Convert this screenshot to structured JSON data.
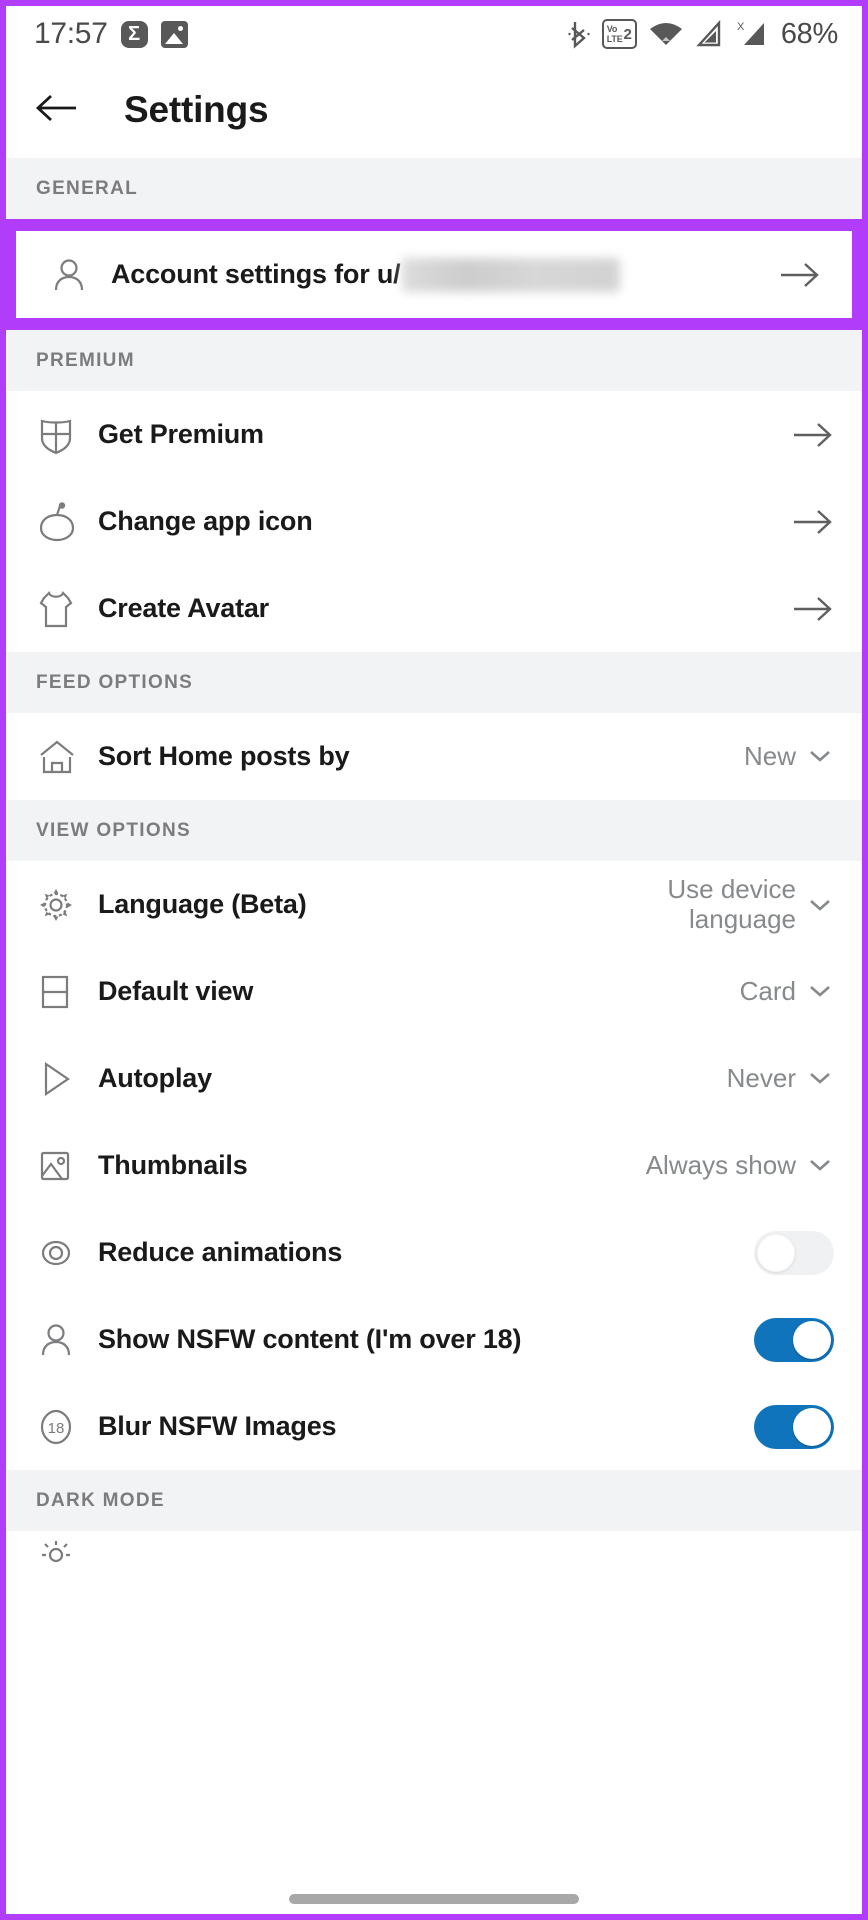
{
  "statusbar": {
    "time": "17:57",
    "sigma_glyph": "Σ",
    "icons": [
      "sigma-icon",
      "gallery-icon",
      "bluetooth-icon",
      "volte-icon",
      "wifi-icon",
      "signal-icon-1",
      "signal-icon-2"
    ],
    "volte": {
      "top": "Vo",
      "bottom": "LTE",
      "num": "2"
    },
    "battery": "68%"
  },
  "appbar": {
    "back_icon": "back-arrow-icon",
    "title": "Settings"
  },
  "colors": {
    "highlight_purple": "#b13cfa",
    "toggle_on_blue": "#1074bc",
    "toggle_off_grey": "#eff1f3",
    "section_bg": "#f2f3f5",
    "label_text": "#1a1a1b",
    "muted_text": "#878a8c"
  },
  "sections": [
    {
      "header": "GENERAL",
      "highlighted": true,
      "rows": [
        {
          "icon": "person-icon",
          "label": "Account settings for u/",
          "blurred_username": true,
          "trailing": "arrow-right-icon"
        }
      ]
    },
    {
      "header": "PREMIUM",
      "rows": [
        {
          "icon": "shield-icon",
          "label": "Get Premium",
          "trailing": "arrow-right-icon"
        },
        {
          "icon": "snoo-icon",
          "label": "Change app icon",
          "trailing": "arrow-right-icon"
        },
        {
          "icon": "tshirt-icon",
          "label": "Create Avatar",
          "trailing": "arrow-right-icon"
        }
      ]
    },
    {
      "header": "FEED OPTIONS",
      "rows": [
        {
          "icon": "home-icon",
          "label": "Sort Home posts by",
          "value": "New",
          "trailing": "chevron-down-icon"
        }
      ]
    },
    {
      "header": "VIEW OPTIONS",
      "rows": [
        {
          "icon": "gear-icon",
          "label": "Language (Beta)",
          "value": "Use device language",
          "trailing": "chevron-down-icon"
        },
        {
          "icon": "card-view-icon",
          "label": "Default view",
          "value": "Card",
          "trailing": "chevron-down-icon"
        },
        {
          "icon": "play-icon",
          "label": "Autoplay",
          "value": "Never",
          "trailing": "chevron-down-icon"
        },
        {
          "icon": "image-icon",
          "label": "Thumbnails",
          "value": "Always show",
          "trailing": "chevron-down-icon"
        },
        {
          "icon": "eye-icon",
          "label": "Reduce animations",
          "toggle": "off"
        },
        {
          "icon": "person-icon",
          "label": "Show NSFW content (I'm over 18)",
          "toggle": "on"
        },
        {
          "icon": "nsfw-18-icon",
          "label": "Blur NSFW Images",
          "toggle": "on"
        }
      ]
    },
    {
      "header": "DARK MODE",
      "rows": []
    }
  ],
  "gesture_bar": "home-gesture-pill"
}
